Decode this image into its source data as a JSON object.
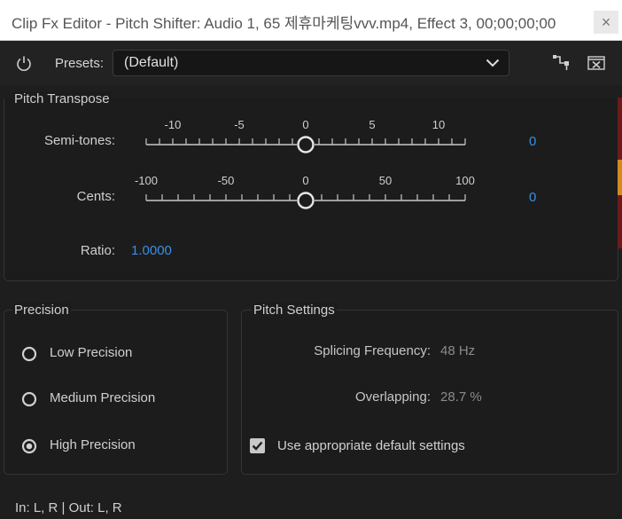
{
  "window": {
    "title": "Clip Fx Editor - Pitch Shifter: Audio 1, 65 제휴마케팅vvv.mp4, Effect 3, 00;00;00;00",
    "close_glyph": "×"
  },
  "toolbar": {
    "icons": [
      "power-icon",
      "routing-icon",
      "close-effect-icon"
    ],
    "presets_label": "Presets:",
    "presets_value": "(Default)"
  },
  "pitch_transpose": {
    "title": "Pitch Transpose",
    "semitones": {
      "label": "Semi-tones:",
      "min": -12,
      "max": 12,
      "value": 0,
      "tick_labels": [
        "-10",
        "-5",
        "0",
        "5",
        "10"
      ],
      "value_text": "0"
    },
    "cents": {
      "label": "Cents:",
      "min": -100,
      "max": 100,
      "value": 0,
      "tick_labels": [
        "-100",
        "-50",
        "0",
        "50",
        "100"
      ],
      "value_text": "0"
    },
    "ratio": {
      "label": "Ratio:",
      "value": "1.0000"
    }
  },
  "precision": {
    "title": "Precision",
    "options": [
      {
        "label": "Low Precision",
        "selected": false
      },
      {
        "label": "Medium Precision",
        "selected": false
      },
      {
        "label": "High Precision",
        "selected": true
      }
    ]
  },
  "pitch_settings": {
    "title": "Pitch Settings",
    "splicing_label": "Splicing Frequency:",
    "splicing_value": "48 Hz",
    "overlapping_label": "Overlapping:",
    "overlapping_value": "28.7 %",
    "default_settings_label": "Use appropriate default settings",
    "default_settings_checked": true
  },
  "io": {
    "text": "In: L, R | Out: L, R"
  },
  "colors": {
    "accent_blue": "#3c8ee6",
    "background": "#1e1e1e",
    "panel_border": "#343434"
  }
}
